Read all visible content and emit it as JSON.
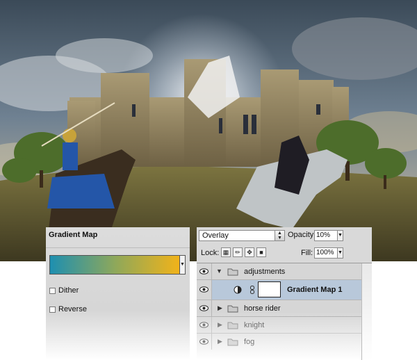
{
  "gradient_map": {
    "title": "Gradient Map",
    "gradient_colors": [
      "#1e8fb0",
      "#8fa85a",
      "#f4b318"
    ],
    "dither_label": "Dither",
    "dither_checked": false,
    "reverse_label": "Reverse",
    "reverse_checked": false
  },
  "layers": {
    "blend_mode": "Overlay",
    "opacity_label": "Opacity:",
    "opacity_value": "10%",
    "lock_label": "Lock:",
    "fill_label": "Fill:",
    "fill_value": "100%",
    "items": [
      {
        "name": "adjustments",
        "kind": "group",
        "expanded": true,
        "visible": true
      },
      {
        "name": "Gradient Map 1",
        "kind": "adjustment",
        "selected": true,
        "visible": true
      },
      {
        "name": "horse rider",
        "kind": "group",
        "expanded": false,
        "visible": true
      },
      {
        "name": "knight",
        "kind": "group",
        "expanded": false,
        "visible": true
      },
      {
        "name": "fog",
        "kind": "group",
        "expanded": false,
        "visible": true
      }
    ]
  },
  "colors": {
    "selection": "#b8c8da",
    "panel_bg": "#d6d6d6"
  }
}
